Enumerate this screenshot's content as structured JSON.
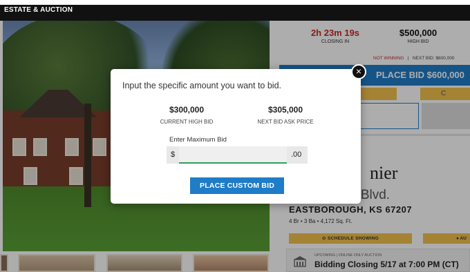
{
  "brand": {
    "text": "ESTATE & AUCTION"
  },
  "panel": {
    "timer_value": "2h 23m 19s",
    "timer_label": "CLOSING IN",
    "high_bid_value": "$500,000",
    "high_bid_label": "HIGH BID",
    "status_not_winning": "NOT WINNING",
    "status_separator": "|",
    "status_next_bid": "NEXT BID: $600,000",
    "place_bid_label": "PLACE BID $600,000",
    "gold_partial_label": "C",
    "address_line1": "nier",
    "address_line2": "d Blvd.",
    "city_line": "EASTBOROUGH, KS 67207",
    "specs": "4 Br • 3 Ba • 4,172 Sq. Ft.",
    "schedule_label": "SCHEDULE SHOWING",
    "auction_partial_label": "AU",
    "info_small": "UPCOMING | ONLINE ONLY AUCTION",
    "info_big": "Bidding Closing 5/17 at 7:00 PM (CT)"
  },
  "modal": {
    "title": "Input the specific amount you want to bid.",
    "close_symbol": "×",
    "current_high_bid_value": "$300,000",
    "current_high_bid_label": "CURRENT HIGH BID",
    "next_bid_value": "$305,000",
    "next_bid_label": "NEXT BID ASK PRICE",
    "enter_label": "Enter Maximum Bid",
    "currency_symbol": "$",
    "input_value": "",
    "cents_suffix": ".00",
    "submit_label": "PLACE CUSTOM BID"
  },
  "colors": {
    "accent_blue": "#1f7cc7",
    "gold": "#f2c14e",
    "alert_red": "#c62828",
    "input_focus_green": "#2e9e5b"
  },
  "icons": {
    "close": "close-icon",
    "schedule": "clock-icon",
    "auction": "info-icon",
    "building": "building-icon"
  }
}
